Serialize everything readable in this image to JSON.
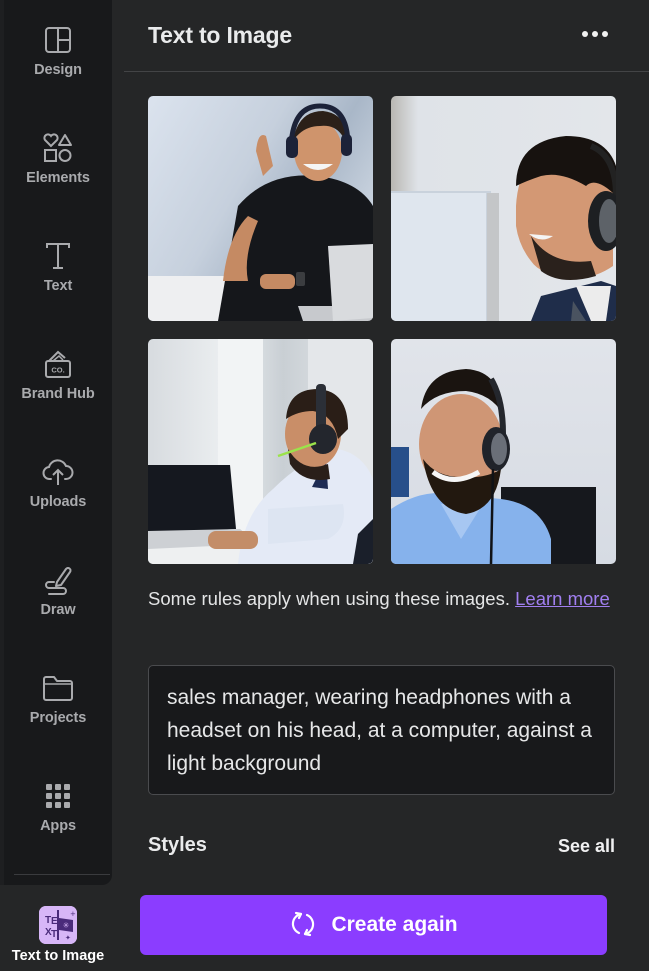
{
  "sidebar": {
    "items": [
      {
        "label": "Design",
        "icon": "layout-icon"
      },
      {
        "label": "Elements",
        "icon": "shapes-icon"
      },
      {
        "label": "Text",
        "icon": "text-icon"
      },
      {
        "label": "Brand Hub",
        "icon": "brand-hub-icon"
      },
      {
        "label": "Uploads",
        "icon": "cloud-upload-icon"
      },
      {
        "label": "Draw",
        "icon": "draw-icon"
      },
      {
        "label": "Projects",
        "icon": "folder-icon"
      },
      {
        "label": "Apps",
        "icon": "apps-grid-icon"
      }
    ],
    "active_app": {
      "label": "Text to Image",
      "icon": "text-to-image-app-icon",
      "icon_letters": [
        "T",
        "E",
        "X",
        "T"
      ]
    }
  },
  "panel": {
    "title": "Text to Image",
    "more_icon": "more-horizontal-icon",
    "results": [
      {
        "alt": "Smiling man in black polo with headphones at laptop, light blue background"
      },
      {
        "alt": "Bearded man in suit with headphones in profile at computer monitor"
      },
      {
        "alt": "Man in light shirt with headset mic typing on laptop in office"
      },
      {
        "alt": "Bearded man in blue shirt with headset smiling in front of monitor"
      }
    ],
    "rules_text": "Some rules apply when using these images. ",
    "rules_link": "Learn more",
    "prompt_value": "sales manager, wearing headphones with a headset on his head, at a computer, against a light background",
    "styles_title": "Styles",
    "see_all": "See all",
    "create_button": "Create again",
    "create_icon": "refresh-icon"
  },
  "colors": {
    "accent": "#8b3dff",
    "link": "#a17ff0",
    "panel_bg": "#252627",
    "rail_bg": "#18191b"
  }
}
